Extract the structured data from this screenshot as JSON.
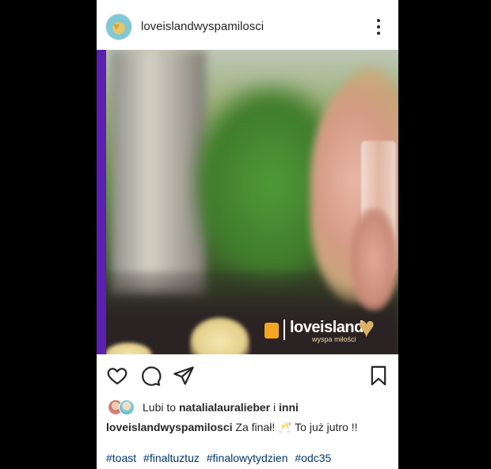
{
  "header": {
    "username": "loveislandwyspamilosci",
    "avatar_icon": "love-island-heart-avatar",
    "more_icon": "three-dots-vertical-icon"
  },
  "media": {
    "overlay_brand": {
      "channel_logo_icon": "polsat-tv-logo",
      "title": "loveisland",
      "subtitle": "wyspa miłości",
      "heart_icon": "gold-glitter-heart"
    },
    "accent_color": "#5a1fb0"
  },
  "actions": {
    "like_icon": "heart-outline-icon",
    "comment_icon": "comment-bubble-icon",
    "share_icon": "paper-plane-icon",
    "save_icon": "bookmark-outline-icon"
  },
  "likes": {
    "prefix": "Lubi to",
    "user": "natalialauralieber",
    "conjunction": "i",
    "others": "inni"
  },
  "caption": {
    "username": "loveislandwyspamilosci",
    "text": "Za finał! 🥂 To już jutro !!"
  },
  "hashtags": [
    "#toast",
    "#finaltuztuz",
    "#finalowytydzien",
    "#odc35"
  ]
}
